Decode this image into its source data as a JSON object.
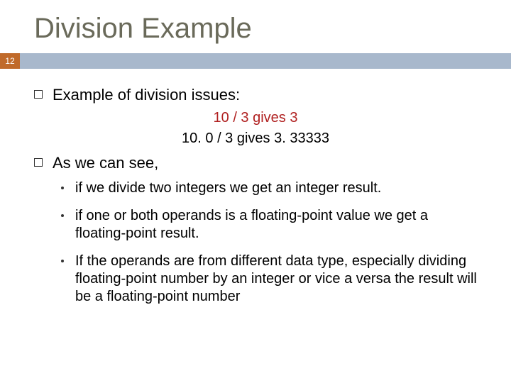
{
  "title": "Division Example",
  "page_number": "12",
  "bullets": [
    {
      "text": "Example of division issues:",
      "example_lines": [
        "10 / 3  gives  3",
        "10. 0 / 3 gives 3. 33333"
      ]
    },
    {
      "text": "As we can see,",
      "sub": [
        "if we divide two integers we get an integer result.",
        "if one or both operands is a floating-point value we get a floating-point result.",
        "If the operands are from different data type, especially dividing floating-point number by an integer or vice a versa the result will be a floating-point number"
      ]
    }
  ],
  "colors": {
    "title": "#6a6a5a",
    "page_badge_bg": "#c06a2a",
    "bar_bg": "#a8b8cc",
    "highlight_text": "#b02020"
  }
}
